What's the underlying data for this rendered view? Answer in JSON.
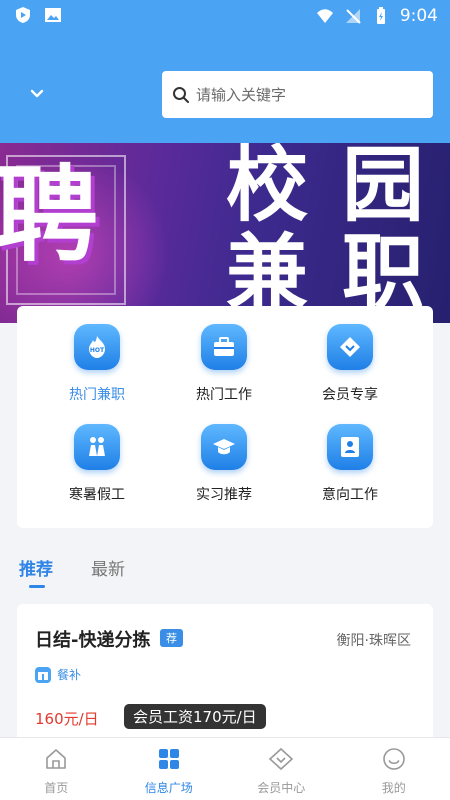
{
  "status_bar": {
    "time": "9:04"
  },
  "header": {
    "search_placeholder": "请输入关键字"
  },
  "banner": {
    "chars": [
      "聘",
      "校",
      "园",
      "兼",
      "职"
    ]
  },
  "categories": [
    {
      "label": "热门兼职",
      "icon": "hot-flame-icon",
      "active": true
    },
    {
      "label": "热门工作",
      "icon": "briefcase-icon"
    },
    {
      "label": "会员专享",
      "icon": "diamond-icon"
    },
    {
      "label": "寒暑假工",
      "icon": "people-icon"
    },
    {
      "label": "实习推荐",
      "icon": "graduation-cap-icon"
    },
    {
      "label": "意向工作",
      "icon": "id-card-icon"
    }
  ],
  "tabs": [
    {
      "label": "推荐",
      "active": true
    },
    {
      "label": "最新"
    }
  ],
  "job": {
    "title": "日结-快递分拣",
    "badge": "荐",
    "location": "衡阳·珠晖区",
    "perk": "餐补",
    "salary": "160元/日",
    "member_salary": "会员工资170元/日"
  },
  "bottom_nav": [
    {
      "label": "首页",
      "icon": "home-icon"
    },
    {
      "label": "信息广场",
      "icon": "grid-icon",
      "active": true
    },
    {
      "label": "会员中心",
      "icon": "diamond-outline-icon"
    },
    {
      "label": "我的",
      "icon": "smile-icon"
    }
  ],
  "colors": {
    "primary": "#4aa3f3",
    "accent": "#2f86e6",
    "price": "#e23a2e"
  }
}
